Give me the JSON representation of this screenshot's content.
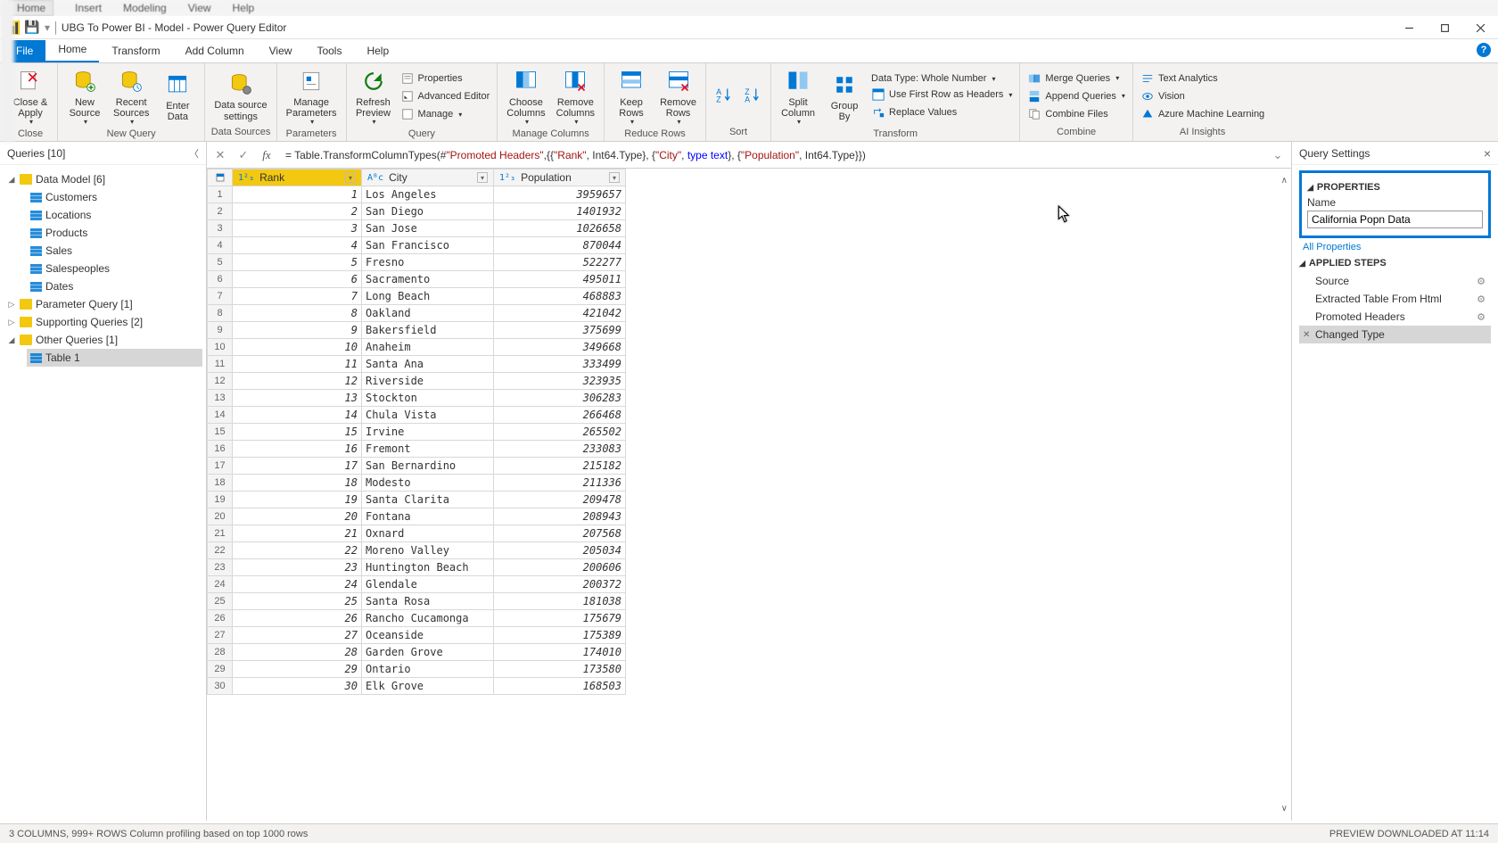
{
  "shell_menu": [
    "Home",
    "Insert",
    "Modeling",
    "View",
    "Help"
  ],
  "titlebar": {
    "title": "UBG To Power BI - Model - Power Query Editor"
  },
  "ribbon_tabs": [
    "File",
    "Home",
    "Transform",
    "Add Column",
    "View",
    "Tools",
    "Help"
  ],
  "ribbon_active_tab": 1,
  "ribbon": {
    "close": {
      "label": "Close &\nApply",
      "group": "Close"
    },
    "newquery": {
      "new_source": "New\nSource",
      "recent_sources": "Recent\nSources",
      "enter_data": "Enter\nData",
      "group": "New Query"
    },
    "datasources": {
      "data_source_settings": "Data source\nsettings",
      "group": "Data Sources"
    },
    "parameters": {
      "manage_parameters": "Manage\nParameters",
      "group": "Parameters"
    },
    "query": {
      "refresh_preview": "Refresh\nPreview",
      "properties": "Properties",
      "advanced_editor": "Advanced Editor",
      "manage": "Manage",
      "group": "Query"
    },
    "manage_columns": {
      "choose": "Choose\nColumns",
      "remove": "Remove\nColumns",
      "group": "Manage Columns"
    },
    "reduce_rows": {
      "keep": "Keep\nRows",
      "remove": "Remove\nRows",
      "group": "Reduce Rows"
    },
    "sort": {
      "group": "Sort"
    },
    "transform": {
      "split": "Split\nColumn",
      "group_by": "Group\nBy",
      "data_type": "Data Type: Whole Number",
      "first_row": "Use First Row as Headers",
      "replace": "Replace Values",
      "group": "Transform"
    },
    "combine": {
      "merge": "Merge Queries",
      "append": "Append Queries",
      "combine_files": "Combine Files",
      "group": "Combine"
    },
    "ai": {
      "text_analytics": "Text Analytics",
      "vision": "Vision",
      "azure_ml": "Azure Machine Learning",
      "group": "AI Insights"
    }
  },
  "queries_pane": {
    "title": "Queries [10]",
    "groups": [
      {
        "name": "Data Model [6]",
        "expanded": true,
        "items": [
          "Customers",
          "Locations",
          "Products",
          "Sales",
          "Salespeoples",
          "Dates"
        ]
      },
      {
        "name": "Parameter Query [1]",
        "expanded": false,
        "items": []
      },
      {
        "name": "Supporting Queries [2]",
        "expanded": false,
        "items": []
      },
      {
        "name": "Other Queries [1]",
        "expanded": true,
        "items": [
          "Table 1"
        ]
      }
    ],
    "selected": "Table 1"
  },
  "formula": {
    "prefix": "= Table.TransformColumnTypes(#",
    "promoted": "\"Promoted Headers\"",
    "mid1": ",{{",
    "rank": "\"Rank\"",
    "mid2": ", Int64.Type}, {",
    "city": "\"City\"",
    "mid3": ", ",
    "typetext": "type text",
    "mid4": "}, {",
    "pop": "\"Population\"",
    "mid5": ", Int64.Type}})"
  },
  "columns": [
    {
      "name": "Rank",
      "type": "1²₃",
      "typeclass": "num",
      "selected": true
    },
    {
      "name": "City",
      "type": "Aᴮc",
      "typeclass": "txt",
      "selected": false
    },
    {
      "name": "Population",
      "type": "1²₃",
      "typeclass": "num",
      "selected": false
    }
  ],
  "rows": [
    {
      "n": 1,
      "rank": 1,
      "city": "Los Angeles",
      "pop": 3959657
    },
    {
      "n": 2,
      "rank": 2,
      "city": "San Diego",
      "pop": 1401932
    },
    {
      "n": 3,
      "rank": 3,
      "city": "San Jose",
      "pop": 1026658
    },
    {
      "n": 4,
      "rank": 4,
      "city": "San Francisco",
      "pop": 870044
    },
    {
      "n": 5,
      "rank": 5,
      "city": "Fresno",
      "pop": 522277
    },
    {
      "n": 6,
      "rank": 6,
      "city": "Sacramento",
      "pop": 495011
    },
    {
      "n": 7,
      "rank": 7,
      "city": "Long Beach",
      "pop": 468883
    },
    {
      "n": 8,
      "rank": 8,
      "city": "Oakland",
      "pop": 421042
    },
    {
      "n": 9,
      "rank": 9,
      "city": "Bakersfield",
      "pop": 375699
    },
    {
      "n": 10,
      "rank": 10,
      "city": "Anaheim",
      "pop": 349668
    },
    {
      "n": 11,
      "rank": 11,
      "city": "Santa Ana",
      "pop": 333499
    },
    {
      "n": 12,
      "rank": 12,
      "city": "Riverside",
      "pop": 323935
    },
    {
      "n": 13,
      "rank": 13,
      "city": "Stockton",
      "pop": 306283
    },
    {
      "n": 14,
      "rank": 14,
      "city": "Chula Vista",
      "pop": 266468
    },
    {
      "n": 15,
      "rank": 15,
      "city": "Irvine",
      "pop": 265502
    },
    {
      "n": 16,
      "rank": 16,
      "city": "Fremont",
      "pop": 233083
    },
    {
      "n": 17,
      "rank": 17,
      "city": "San Bernardino",
      "pop": 215182
    },
    {
      "n": 18,
      "rank": 18,
      "city": "Modesto",
      "pop": 211336
    },
    {
      "n": 19,
      "rank": 19,
      "city": "Santa Clarita",
      "pop": 209478
    },
    {
      "n": 20,
      "rank": 20,
      "city": "Fontana",
      "pop": 208943
    },
    {
      "n": 21,
      "rank": 21,
      "city": "Oxnard",
      "pop": 207568
    },
    {
      "n": 22,
      "rank": 22,
      "city": "Moreno Valley",
      "pop": 205034
    },
    {
      "n": 23,
      "rank": 23,
      "city": "Huntington Beach",
      "pop": 200606
    },
    {
      "n": 24,
      "rank": 24,
      "city": "Glendale",
      "pop": 200372
    },
    {
      "n": 25,
      "rank": 25,
      "city": "Santa Rosa",
      "pop": 181038
    },
    {
      "n": 26,
      "rank": 26,
      "city": "Rancho Cucamonga",
      "pop": 175679
    },
    {
      "n": 27,
      "rank": 27,
      "city": "Oceanside",
      "pop": 175389
    },
    {
      "n": 28,
      "rank": 28,
      "city": "Garden Grove",
      "pop": 174010
    },
    {
      "n": 29,
      "rank": 29,
      "city": "Ontario",
      "pop": 173580
    },
    {
      "n": 30,
      "rank": 30,
      "city": "Elk Grove",
      "pop": 168503
    }
  ],
  "query_settings": {
    "title": "Query Settings",
    "properties_hdr": "PROPERTIES",
    "name_label": "Name",
    "name_value": "California Popn Data",
    "all_properties": "All Properties",
    "applied_steps_hdr": "APPLIED STEPS",
    "steps": [
      {
        "name": "Source",
        "gear": true
      },
      {
        "name": "Extracted Table From Html",
        "gear": true
      },
      {
        "name": "Promoted Headers",
        "gear": true
      },
      {
        "name": "Changed Type",
        "gear": false,
        "selected": true
      }
    ]
  },
  "statusbar": {
    "left": "3 COLUMNS, 999+ ROWS    Column profiling based on top 1000 rows",
    "right": "PREVIEW DOWNLOADED AT 11:14"
  }
}
